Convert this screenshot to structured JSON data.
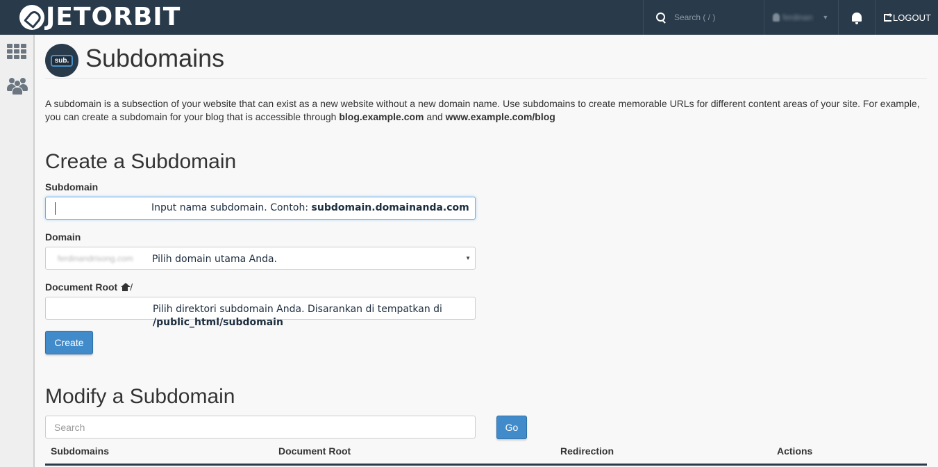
{
  "app": {
    "logo_text": "JETORBIT"
  },
  "topbar": {
    "search_placeholder": "Search ( / )",
    "username": "ferdinan",
    "logout_label": "LOGOUT"
  },
  "page": {
    "badge": "sub.",
    "title": "Subdomains",
    "description_1": "A subdomain is a subsection of your website that can exist as a new website without a new domain name. Use subdomains to create memorable URLs for different content areas of your site. For example, you can create a subdomain for your blog that is accessible through ",
    "description_bold_1": "blog.example.com",
    "description_and": " and ",
    "description_bold_2": "www.example.com/blog"
  },
  "create": {
    "heading": "Create a Subdomain",
    "subdomain_label": "Subdomain",
    "subdomain_hint": "Input nama subdomain. Contoh: ",
    "subdomain_hint_bold": "subdomain.domainanda.com",
    "domain_label": "Domain",
    "domain_value": "ferdinandrisong.com",
    "domain_hint": "Pilih domain utama Anda.",
    "docroot_label": "Document Root",
    "docroot_suffix": "/",
    "docroot_hint": "Pilih direktori subdomain Anda. Disarankan di tempatkan di",
    "docroot_hint_bold": "/public_html/subdomain",
    "create_button": "Create"
  },
  "modify": {
    "heading": "Modify a Subdomain",
    "search_placeholder": "Search",
    "go_button": "Go",
    "columns": [
      "Subdomains",
      "Document Root",
      "Redirection",
      "Actions"
    ]
  },
  "colors": {
    "topbar": "#293a4a",
    "primary_button": "#428bca",
    "table_rule": "#2b3a48"
  }
}
